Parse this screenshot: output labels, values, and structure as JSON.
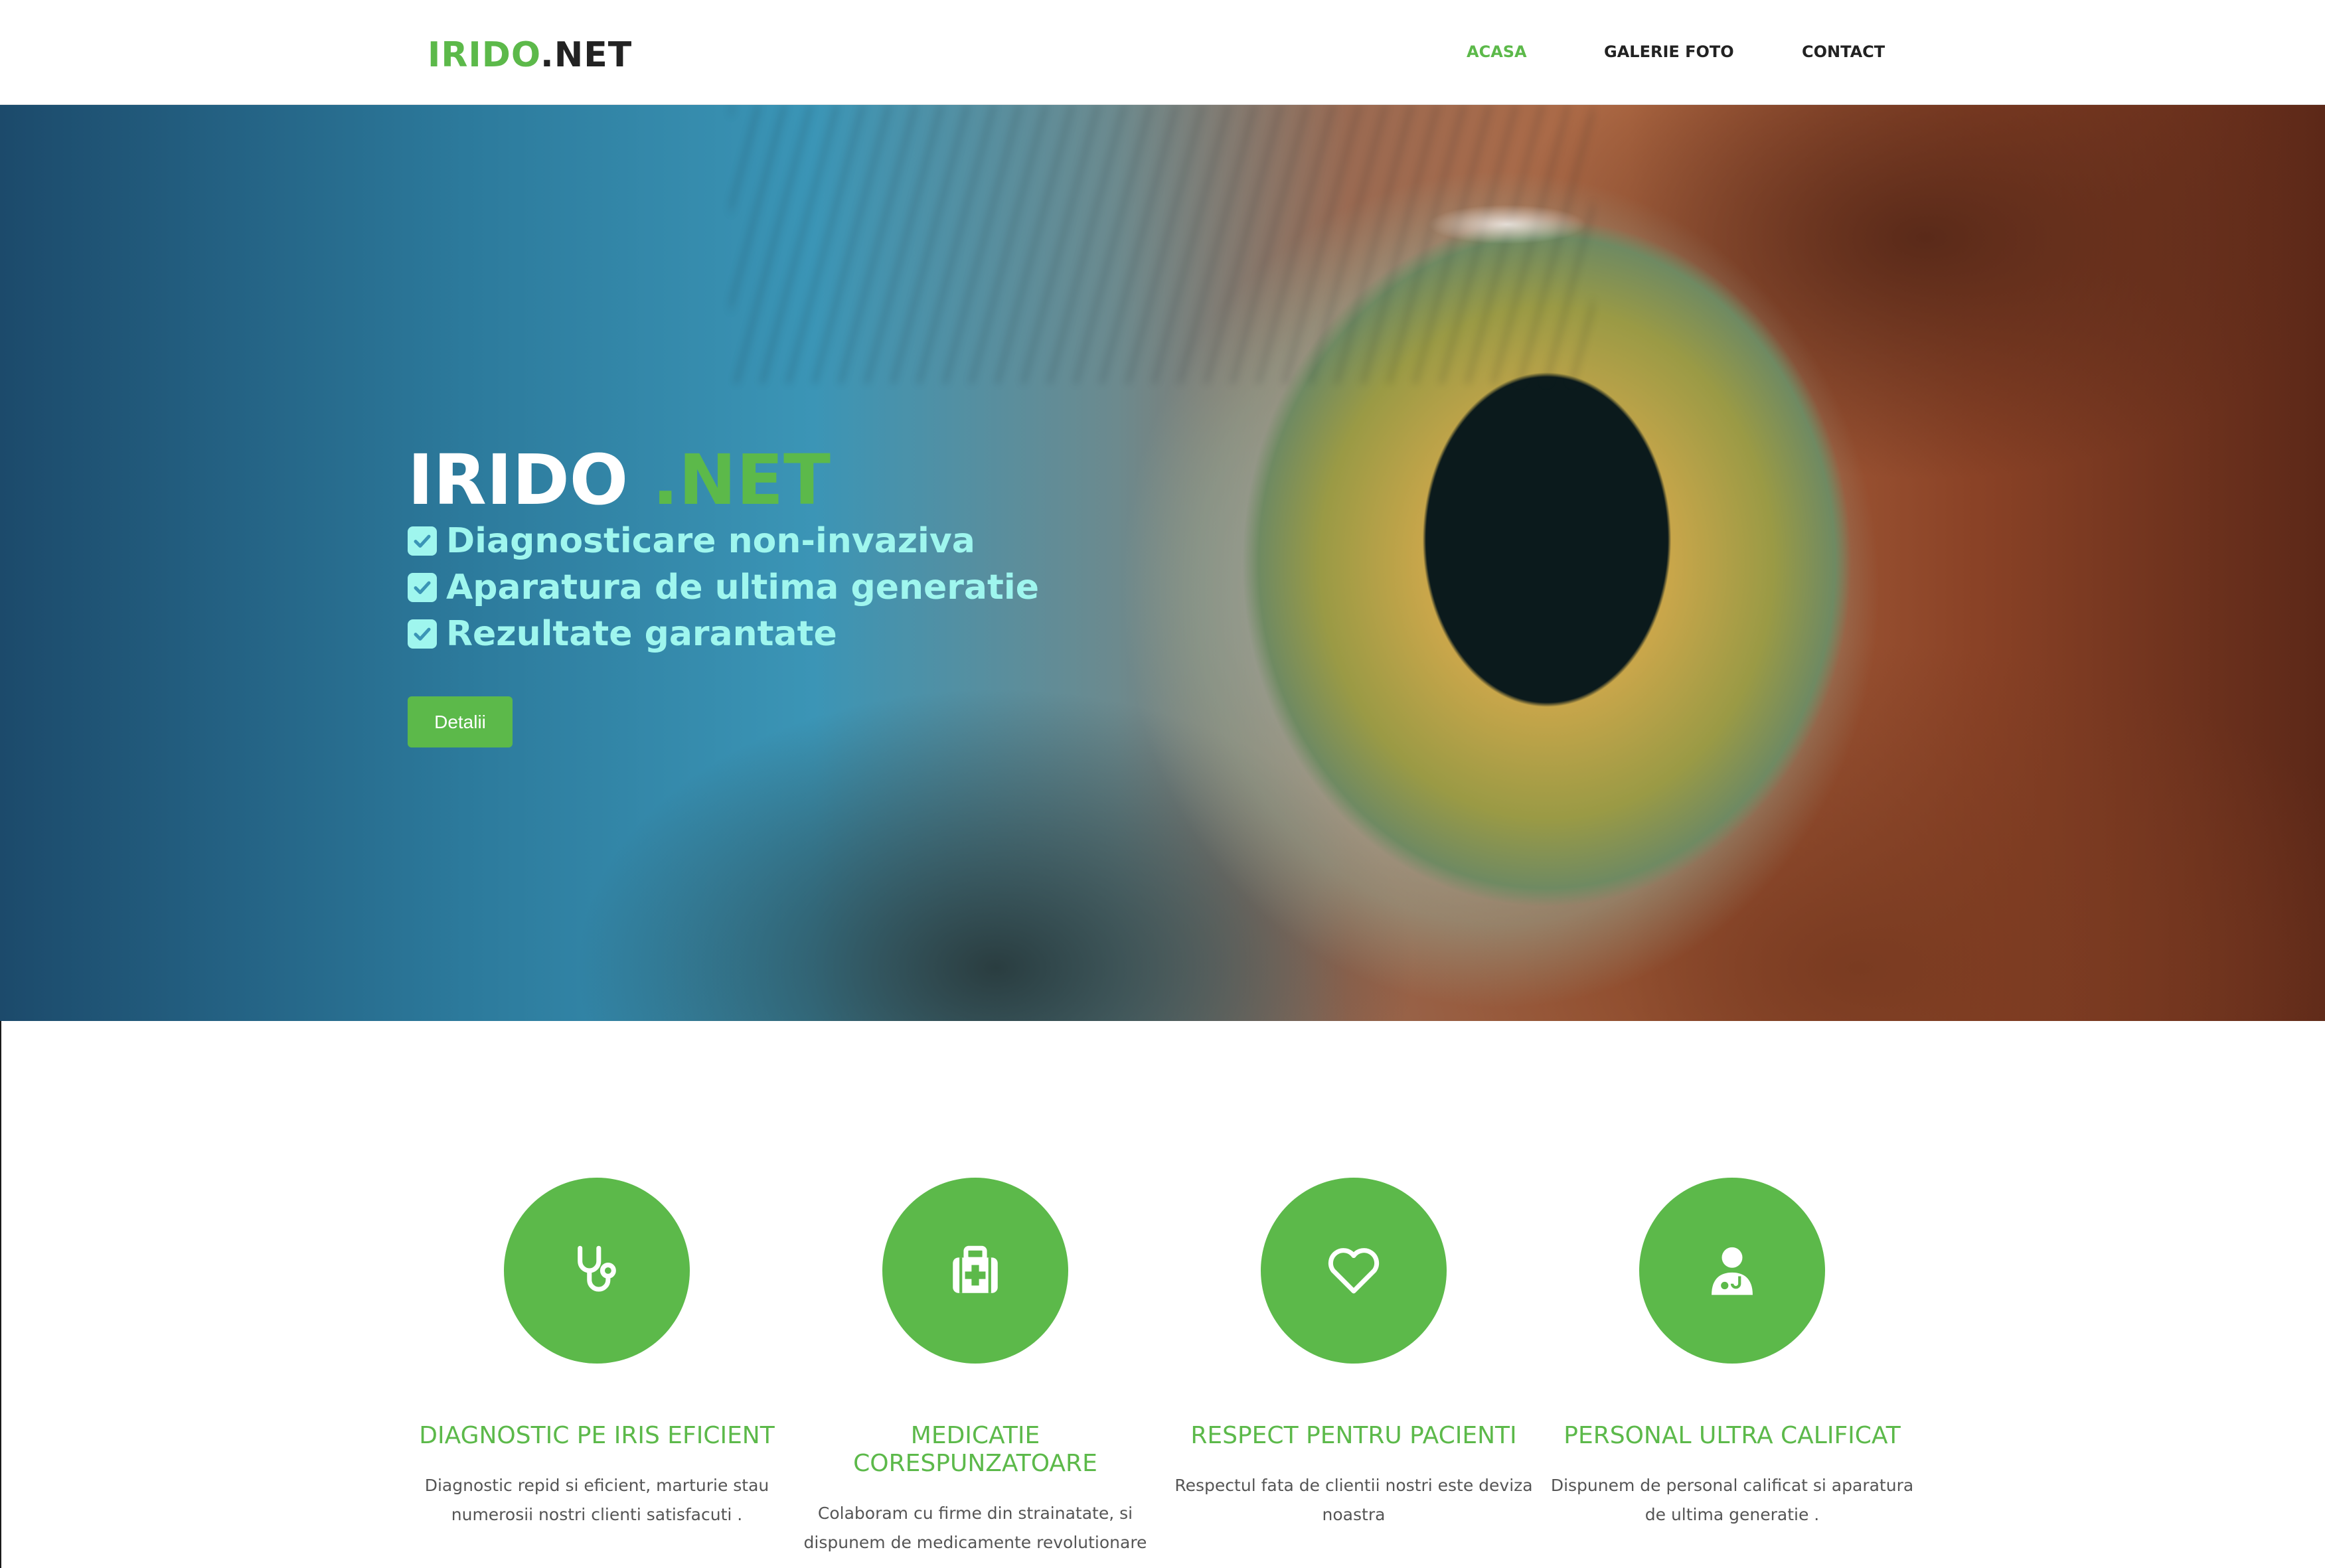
{
  "header": {
    "logo_green": "IRIDO",
    "logo_dark": ".NET",
    "nav": [
      {
        "label": "ACASA",
        "active": true
      },
      {
        "label": "GALERIE FOTO",
        "active": false
      },
      {
        "label": "CONTACT",
        "active": false
      }
    ]
  },
  "hero": {
    "title_main": "IRIDO",
    "title_accent": ".NET",
    "features": [
      "Diagnosticare non-invaziva",
      "Aparatura de ultima generatie",
      "Rezultate garantate"
    ],
    "button_label": "Detalii"
  },
  "services": [
    {
      "icon": "stethoscope-icon",
      "title": "DIAGNOSTIC PE IRIS EFICIENT",
      "description": "Diagnostic repid si eficient, marturie stau numerosii nostri clienti satisfacuti ."
    },
    {
      "icon": "medkit-icon",
      "title": "MEDICATIE CORESPUNZATOARE",
      "description": "Colaboram cu firme din strainatate, si dispunem de medicamente revolutionare"
    },
    {
      "icon": "heart-icon",
      "title": "RESPECT PENTRU PACIENTI",
      "description": "Respectul fata de clientii nostri este deviza noastra"
    },
    {
      "icon": "doctor-icon",
      "title": "PERSONAL ULTRA CALIFICAT",
      "description": "Dispunem de personal calificat si aparatura de ultima generatie ."
    }
  ],
  "colors": {
    "accent": "#5cb94a",
    "feature_text": "#9ff6ee",
    "dark_text": "#222222"
  }
}
